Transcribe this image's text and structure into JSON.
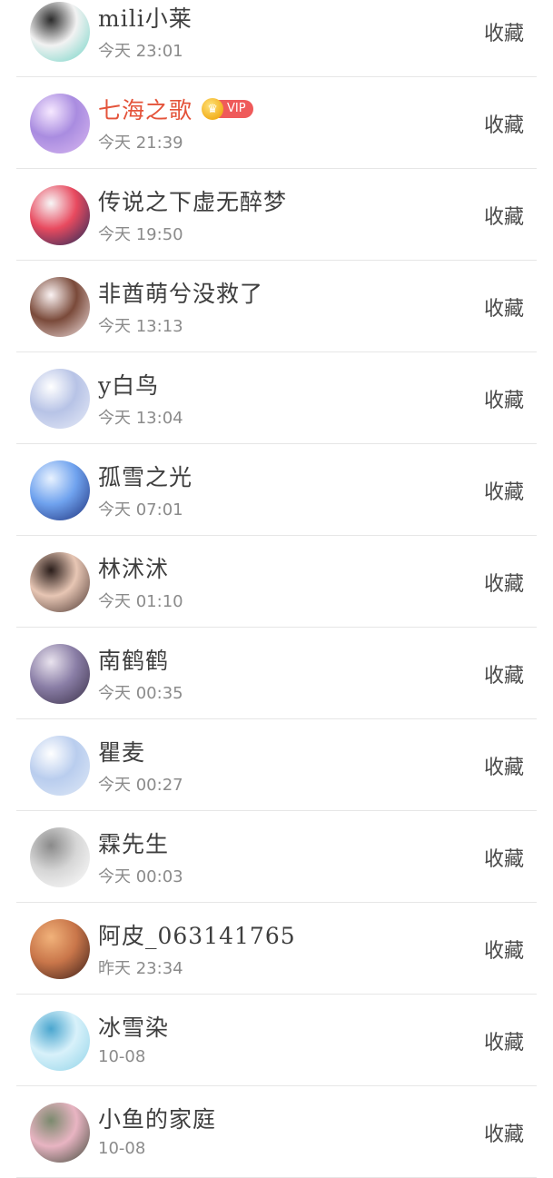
{
  "favorite_label": "收藏",
  "rows": [
    {
      "name": "mili小莱",
      "time": "今天 23:01",
      "vip": false,
      "avatar_colors": [
        "#6fd3c5",
        "#f2f2f2",
        "#2b2b2b"
      ]
    },
    {
      "name": "七海之歌",
      "time": "今天 21:39",
      "vip": true,
      "vip_label": "VIP",
      "avatar_colors": [
        "#d9b8f0",
        "#a98ce0",
        "#f6e8ff"
      ]
    },
    {
      "name": "传说之下虚无醉梦",
      "time": "今天 19:50",
      "vip": false,
      "avatar_colors": [
        "#1b2a5a",
        "#e84a5f",
        "#f7f7f7"
      ]
    },
    {
      "name": "非酋萌兮没救了",
      "time": "今天 13:13",
      "vip": false,
      "avatar_colors": [
        "#f3e3e3",
        "#7a4a3a",
        "#fbf3f3"
      ]
    },
    {
      "name": "y白鸟",
      "time": "今天 13:04",
      "vip": false,
      "avatar_colors": [
        "#e8ecf8",
        "#b7c3e6",
        "#ffffff"
      ]
    },
    {
      "name": "孤雪之光",
      "time": "今天 07:01",
      "vip": false,
      "avatar_colors": [
        "#1d2f7a",
        "#6fa2ee",
        "#e8f2ff"
      ]
    },
    {
      "name": "林沭沭",
      "time": "今天 01:10",
      "vip": false,
      "avatar_colors": [
        "#4a3530",
        "#e7c6b4",
        "#2a1d1a"
      ]
    },
    {
      "name": "南鹤鹤",
      "time": "今天 00:35",
      "vip": false,
      "avatar_colors": [
        "#3a3048",
        "#8a7ea6",
        "#e9e3ee"
      ]
    },
    {
      "name": "瞿麦",
      "time": "今天 00:27",
      "vip": false,
      "avatar_colors": [
        "#dfe9f7",
        "#b9cdee",
        "#ffffff"
      ]
    },
    {
      "name": "霖先生",
      "time": "今天 00:03",
      "vip": false,
      "avatar_colors": [
        "#ffffff",
        "#d6d6d6",
        "#8a8a8a"
      ]
    },
    {
      "name": "阿皮_063141765",
      "time": "昨天 23:34",
      "vip": false,
      "avatar_colors": [
        "#3a1e18",
        "#c9764a",
        "#f1b27a"
      ]
    },
    {
      "name": "冰雪染",
      "time": "10-08",
      "vip": false,
      "avatar_colors": [
        "#8fd3e8",
        "#d8f1fa",
        "#4aa6cf"
      ]
    },
    {
      "name": "小鱼的家庭",
      "time": "10-08",
      "vip": false,
      "avatar_colors": [
        "#3f4a3a",
        "#e8b4c2",
        "#7b8a6e"
      ]
    }
  ]
}
